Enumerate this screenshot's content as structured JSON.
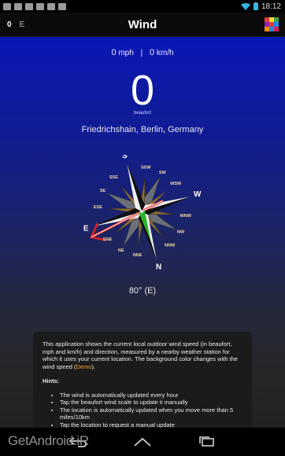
{
  "status_bar": {
    "time": "18:12"
  },
  "action_bar": {
    "beaufort_short": "0",
    "direction_short": "E",
    "title": "Wind"
  },
  "readout": {
    "mph_value": "0",
    "mph_unit": "mph",
    "separator": "|",
    "kmh_value": "0",
    "kmh_unit": "km/h",
    "beaufort_value": "0",
    "beaufort_unit": "beaufort"
  },
  "location": "Friedrichshain, Berlin, Germany",
  "compass": {
    "direction_degrees": 80,
    "labels": {
      "N": "N",
      "NNE": "NNE",
      "NE": "NE",
      "ENE": "ENE",
      "E": "E",
      "ESE": "ESE",
      "SE": "SE",
      "SSE": "SSE",
      "S": "S",
      "SSW": "SSW",
      "SW": "SW",
      "WSW": "WSW",
      "W": "W",
      "WNW": "WNW",
      "NW": "NW",
      "NNW": "NNW"
    }
  },
  "direction_text": "80° (E)",
  "info": {
    "description_pre": "This application shows the current local outdoor wind speed (in beaufort, mph and km/h) and direction, measured by a nearby weather station for which it uses your current location. The background color changes with the wind speed (",
    "demo_link": "Demo",
    "description_post": ").",
    "hints_title": "Hints:",
    "hints": [
      "The wind is automatically updated every hour",
      "Tap the beaufort wind scale to update it manually",
      "The location is automatically updated when you move more than 5 miles/10km",
      "Tap the location to request a manual update"
    ]
  },
  "watermark": "GetAndroid.iR",
  "colors": {
    "background_top": "#0a17b5",
    "background_bottom": "#262626",
    "demo_link": "#f5a623",
    "arrow_red": "#e02020",
    "needle_green": "#2ab52a"
  }
}
